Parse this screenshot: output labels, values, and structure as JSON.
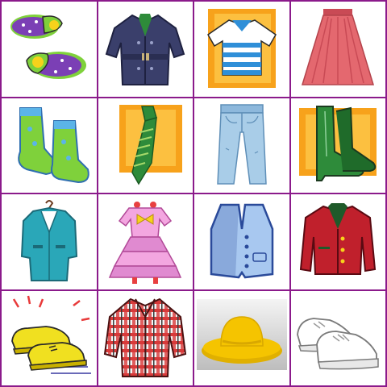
{
  "grid": {
    "rows": 4,
    "columns": 4,
    "border_color": "#8b1a8b"
  },
  "cards": [
    {
      "icon": "slippers-icon"
    },
    {
      "icon": "trench-coat-icon"
    },
    {
      "icon": "striped-shirt-icon"
    },
    {
      "icon": "skirt-icon"
    },
    {
      "icon": "socks-icon"
    },
    {
      "icon": "necktie-icon"
    },
    {
      "icon": "jeans-icon"
    },
    {
      "icon": "high-heel-boot-icon"
    },
    {
      "icon": "suit-icon"
    },
    {
      "icon": "dress-icon"
    },
    {
      "icon": "vest-icon"
    },
    {
      "icon": "red-jacket-icon"
    },
    {
      "icon": "shoes-icon"
    },
    {
      "icon": "plaid-shirt-icon"
    },
    {
      "icon": "hat-icon"
    },
    {
      "icon": "sneakers-icon"
    }
  ],
  "colors": {
    "slipper_purple": "#7b3fb5",
    "slipper_sole": "#7fd13b",
    "coat": "#3a3f6b",
    "shirt_stripe": "#2f8fd8",
    "skirt": "#e4686f",
    "sock": "#7fd13b",
    "tie": "#2e8b3a",
    "jeans": "#a9cde8",
    "boot": "#2e8b3a",
    "suit": "#2aa7b8",
    "dress": "#f3a6e0",
    "vest": "#a8c8f0",
    "jacket": "#c0202c",
    "shoe": "#f0e020",
    "plaid": "#d83a3a",
    "hat": "#f5c400",
    "accent_orange": "#f7a21b"
  }
}
